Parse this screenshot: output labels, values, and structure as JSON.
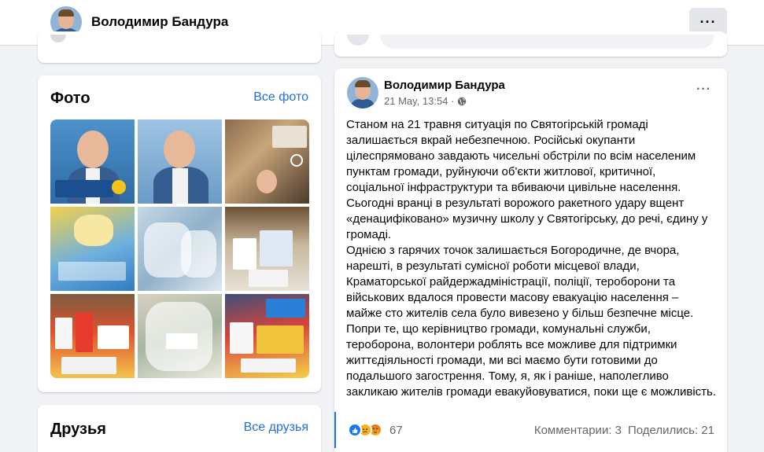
{
  "header": {
    "profile_name": "Володимир Бандура",
    "more_icon": "more-horizontal-icon",
    "more_label": "···"
  },
  "photos": {
    "title": "Фото",
    "see_all": "Все фото",
    "items": [
      "photo-1",
      "photo-2",
      "photo-3",
      "photo-4",
      "photo-5",
      "photo-6",
      "photo-7",
      "photo-8",
      "photo-9"
    ]
  },
  "friends": {
    "title": "Друзья",
    "see_all": "Все друзья"
  },
  "post": {
    "author": "Володимир Бандура",
    "date": "21 May, 13:54 ·",
    "privacy_icon": "globe-icon",
    "more_label": "···",
    "text": "Станом на 21 травня ситуація по Святогірській громаді залишається вкрай небезпечною. Російські окупанти цілеспрямовано завдають чисельні обстріли по всім населеним пунктам громади, руйнуючи об'єкти житлової, критичної, соціальної інфраструктури та вбиваючи цивільне населення.\nСьогодні вранці в результаті ворожого ракетного удару вщент «денацифіковано»  музичну школу у Святогірську,  до речі, єдину у громаді.\nОднією з гарячих точок залишається  Богородичне, де  вчора, нарешті, в результаті сумісної роботи місцевої влади, Краматорської райдержадміністрації, поліції, теробoрони та військових вдалося провести масову евакуацію населення – майже сто жителів села було вивезено у більш безпечне місце.\nПопри те, що керівництво громади, комунальні служби, теробoрона, волонтери роблять все можливе для підтримки життєдіяльності громади, ми всі маємо бути готовими до подальшого загострення. Тому, я,  як і раніше, наполегливо закликаю жителів громади евакуйовуватися, поки ще є можливість.",
    "reactions": {
      "icons": [
        "like-reaction-icon",
        "sad-reaction-icon",
        "angry-reaction-icon"
      ],
      "count": "67"
    },
    "comments": "Комментарии: 3",
    "shares": "Поделились: 21"
  }
}
